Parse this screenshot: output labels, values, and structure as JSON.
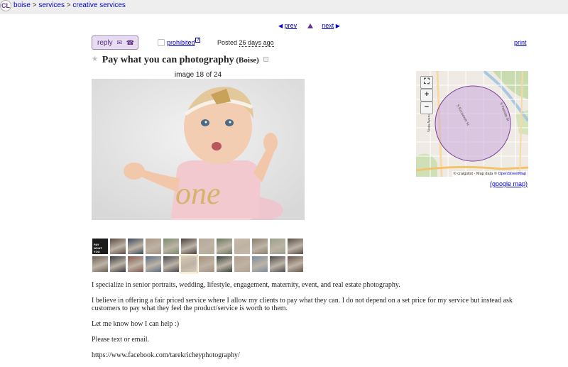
{
  "topbar": {
    "logo": "CL",
    "breadcrumb": {
      "city": "boise",
      "sep1": " > ",
      "category": "services",
      "sep2": " > ",
      "subcategory": "creative services"
    }
  },
  "nav": {
    "prev_arrow": "◀",
    "prev": "prev",
    "next": "next",
    "next_arrow": "▶"
  },
  "post_bar": {
    "reply": "reply",
    "prohibited": "prohibited",
    "help": "?",
    "posted_label": "Posted",
    "posted_date": "26 days ago",
    "print": "print"
  },
  "post": {
    "title": "Pay what you can photography",
    "location": "(Boise)",
    "image_counter": "image 18 of 24",
    "main_image_text": "one",
    "first_thumb_text": "PAY WHAT YOU CAN",
    "thumbnails": [
      "#1b1b1b",
      "#5e4a44",
      "#3d4a5a",
      "#a89682",
      "#7b8c6e",
      "#4a4140",
      "#b8a99a",
      "#6a7a5c",
      "#c7b9a8",
      "#8c7f6e",
      "#9aa28a",
      "#5a4e45",
      "#6e6256",
      "#3a3a40",
      "#8a5a50",
      "#5b6e84",
      "#4c4a52",
      "#d9c8b2",
      "#a99078",
      "#39463a",
      "#b5a089",
      "#7a8ea0",
      "#4d4d4d",
      "#6b5548"
    ],
    "body": [
      "I specialize in senior portraits, wedding, lifestyle, engagement, maternity, event, and real estate photography.",
      "I believe in offering a fair priced service where I allow my clients to pay what they can. I do not depend on a set price for my service but instead ask customers to pay what they feel the product/service is worth to them.",
      "Let me know how I can help :)",
      "Please text or email.",
      "https://www.facebook.com/tarekricheyphotography/"
    ]
  },
  "map": {
    "fullscreen_icon": "⛶",
    "zoom_in": "+",
    "zoom_out": "−",
    "attribution_prefix": "© craigslist - Map data ©",
    "attribution_link": "OpenStreetMap",
    "street_labels": [
      "Vista Avenue",
      "S Roosevelt St",
      "S Pamela St"
    ],
    "google_map_link": "(google map)",
    "colors": {
      "radius_fill": "#c9a7d9",
      "radius_stroke": "#7a3f99"
    }
  },
  "colors": {
    "link": "#0000cc",
    "brand": "#663399"
  }
}
